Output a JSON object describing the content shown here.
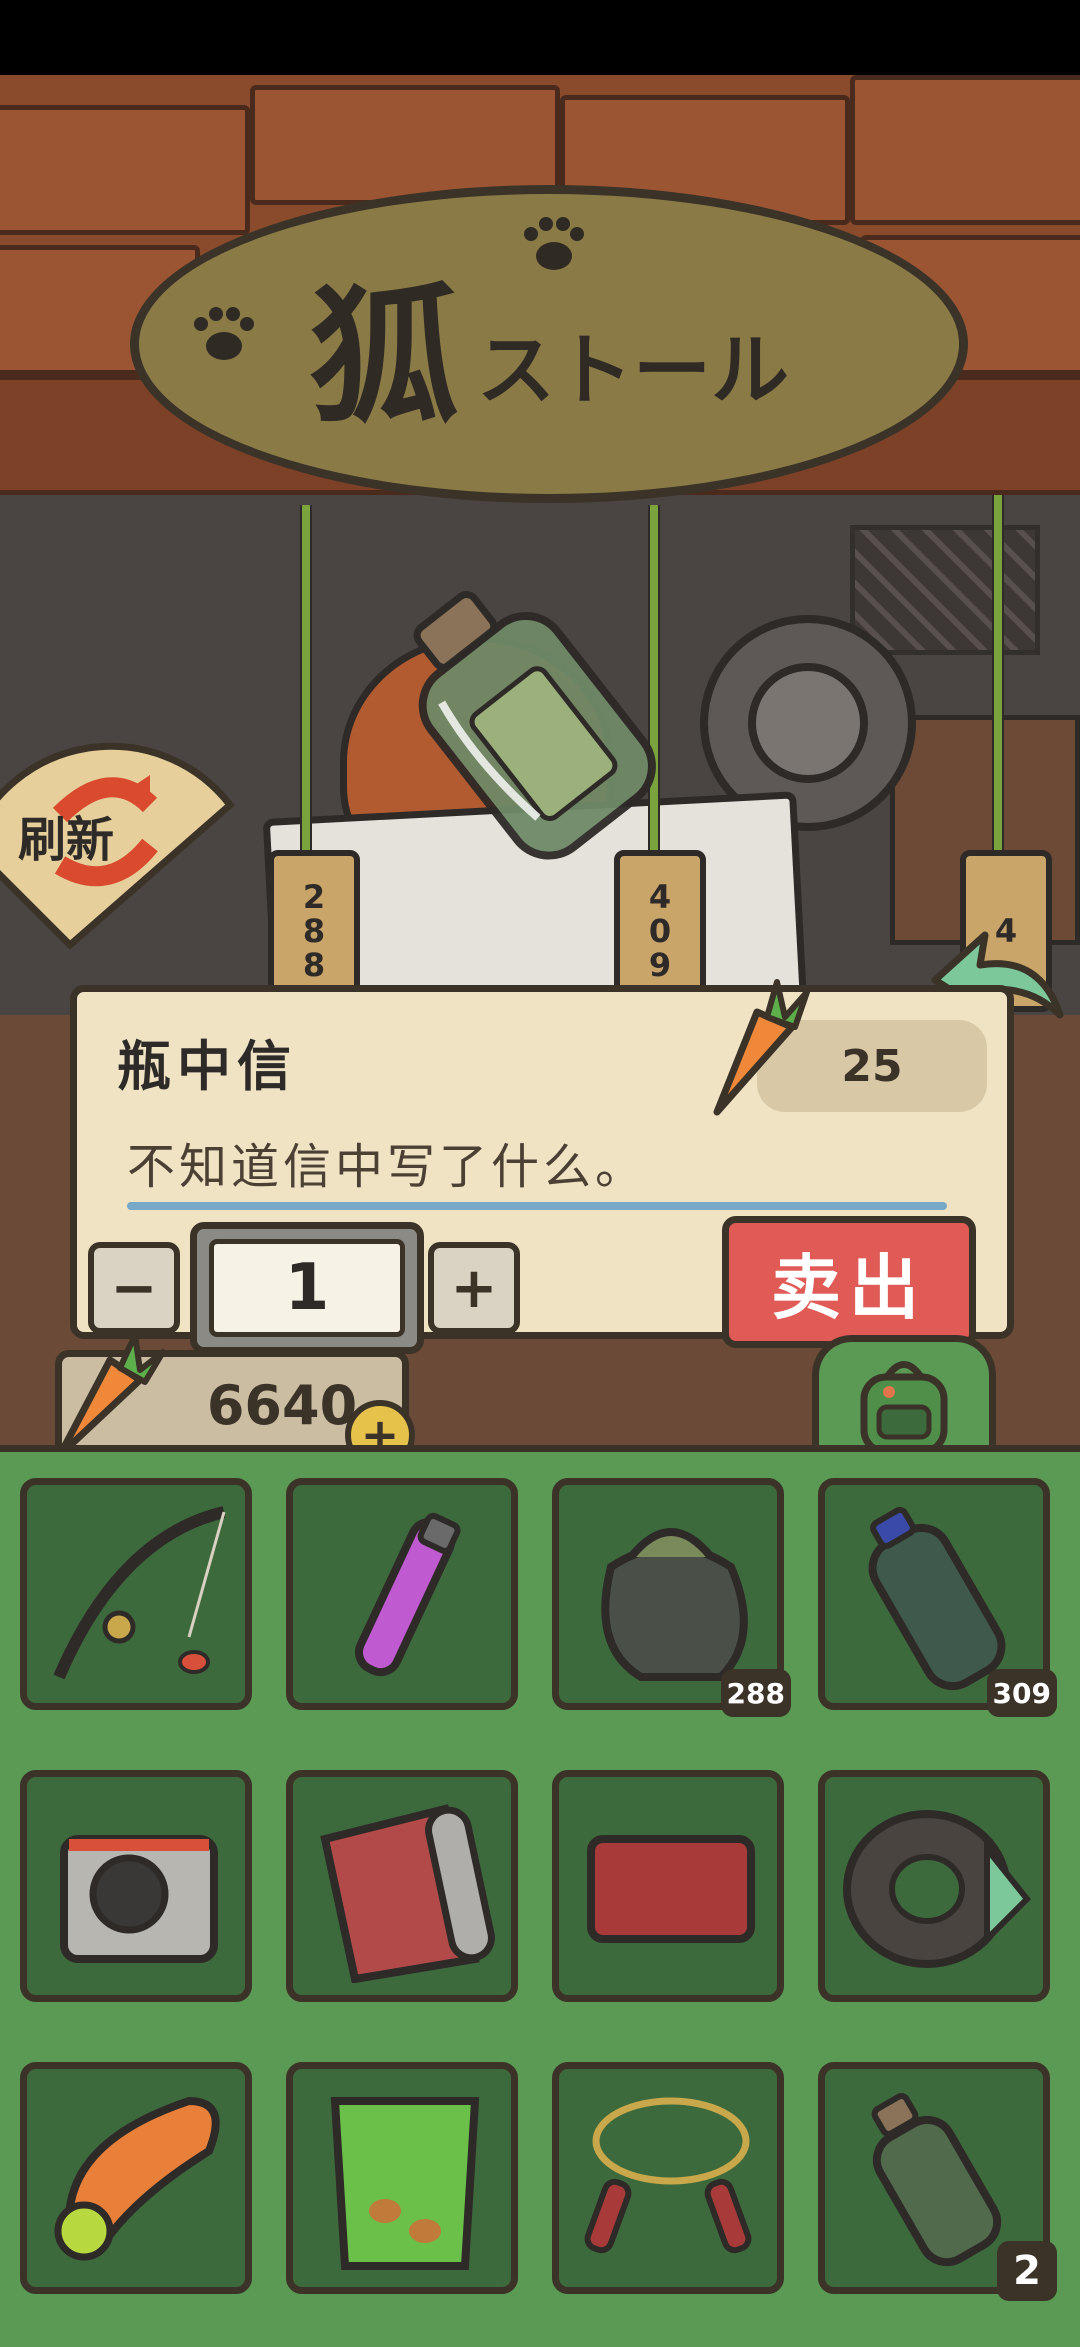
{
  "shop": {
    "sign_title": "狐",
    "sign_subtitle": "ストール",
    "refresh_label": "刷新",
    "tag_prices": [
      [
        "2",
        "8",
        "8"
      ],
      [
        "4",
        "0",
        "9"
      ],
      [
        "4"
      ]
    ]
  },
  "item_panel": {
    "name": "瓶中信",
    "price": "25",
    "description": "不知道信中写了什么。",
    "quantity": "1",
    "minus_label": "−",
    "plus_label": "+",
    "sell_label": "卖出"
  },
  "wallet": {
    "carrots": "6640",
    "add_label": "+"
  },
  "inventory": {
    "items": [
      {
        "icon": "fishing-rod-icon",
        "count": ""
      },
      {
        "icon": "potion-vial-icon",
        "count": ""
      },
      {
        "icon": "trash-bag-icon",
        "count": "288"
      },
      {
        "icon": "plastic-bottle-icon",
        "count": "309"
      },
      {
        "icon": "instant-camera-icon",
        "count": ""
      },
      {
        "icon": "rolled-mat-icon",
        "count": ""
      },
      {
        "icon": "ticket-card-icon",
        "count": ""
      },
      {
        "icon": "fur-scarf-icon",
        "count": ""
      },
      {
        "icon": "swim-ring-icon",
        "count": ""
      },
      {
        "icon": "snack-bag-icon",
        "count": ""
      },
      {
        "icon": "jump-rope-icon",
        "count": ""
      },
      {
        "icon": "message-bottle-icon",
        "count": "2"
      }
    ]
  },
  "colors": {
    "inventory_bg": "#5a9a54",
    "slot_bg": "#3d6a3c",
    "sell_button": "#e05a56",
    "panel_bg": "#efe3c4",
    "outline": "#3b3328"
  }
}
